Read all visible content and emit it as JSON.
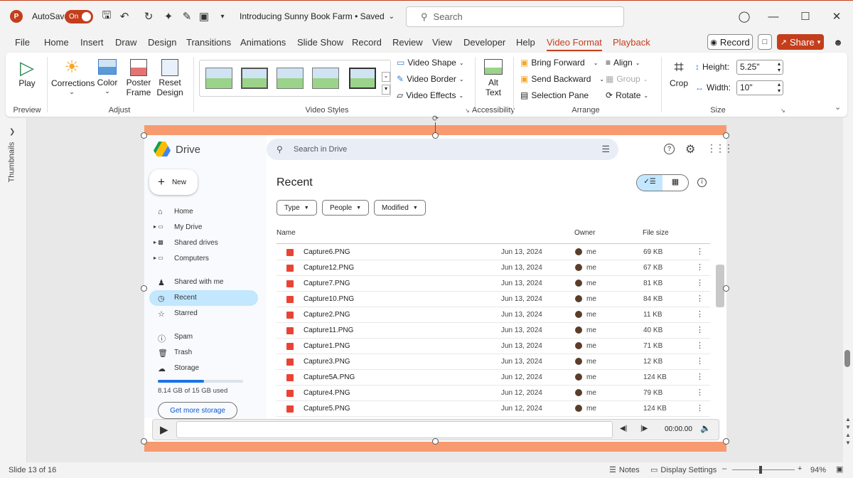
{
  "title_bar": {
    "autosave_label": "AutoSave",
    "autosave_state": "On",
    "document_title": "Introducing Sunny Book Farm • Saved",
    "search_placeholder": "Search"
  },
  "menu": {
    "tabs": [
      "File",
      "Home",
      "Insert",
      "Draw",
      "Design",
      "Transitions",
      "Animations",
      "Slide Show",
      "Record",
      "Review",
      "View",
      "Developer",
      "Help",
      "Video Format",
      "Playback"
    ],
    "active_tab": "Video Format",
    "record_label": "Record",
    "share_label": "Share"
  },
  "ribbon": {
    "preview": {
      "play_label": "Play",
      "group_label": "Preview"
    },
    "adjust": {
      "corrections_label": "Corrections",
      "color_label": "Color",
      "poster_frame_label": "Poster Frame",
      "reset_design_label": "Reset Design",
      "group_label": "Adjust"
    },
    "video_styles": {
      "video_shape_label": "Video Shape",
      "video_border_label": "Video Border",
      "video_effects_label": "Video Effects",
      "group_label": "Video Styles"
    },
    "accessibility": {
      "alt_text_label": "Alt Text",
      "group_label": "Accessibility"
    },
    "arrange": {
      "bring_forward_label": "Bring Forward",
      "send_backward_label": "Send Backward",
      "selection_pane_label": "Selection Pane",
      "align_label": "Align",
      "group_btn_label": "Group",
      "rotate_label": "Rotate",
      "group_label": "Arrange"
    },
    "size": {
      "crop_label": "Crop",
      "height_label": "Height:",
      "height_value": "5.25\"",
      "width_label": "Width:",
      "width_value": "10\"",
      "group_label": "Size"
    }
  },
  "thumbnails_label": "Thumbnails",
  "drive": {
    "logo_text": "Drive",
    "search_placeholder": "Search in Drive",
    "new_label": "New",
    "nav": [
      "Home",
      "My Drive",
      "Shared drives",
      "Computers",
      "Shared with me",
      "Recent",
      "Starred",
      "Spam",
      "Trash",
      "Storage"
    ],
    "storage_text": "8.14 GB of 15 GB used",
    "storage_fraction": 0.543,
    "get_storage_label": "Get more storage",
    "page_title": "Recent",
    "filters": [
      "Type",
      "People",
      "Modified"
    ],
    "columns": {
      "name": "Name",
      "owner": "Owner",
      "size": "File size"
    },
    "files": [
      {
        "name": "Capture6.PNG",
        "date": "Jun 13, 2024",
        "owner": "me",
        "size": "69 KB"
      },
      {
        "name": "Capture12.PNG",
        "date": "Jun 13, 2024",
        "owner": "me",
        "size": "67 KB"
      },
      {
        "name": "Capture7.PNG",
        "date": "Jun 13, 2024",
        "owner": "me",
        "size": "81 KB"
      },
      {
        "name": "Capture10.PNG",
        "date": "Jun 13, 2024",
        "owner": "me",
        "size": "84 KB"
      },
      {
        "name": "Capture2.PNG",
        "date": "Jun 13, 2024",
        "owner": "me",
        "size": "11 KB"
      },
      {
        "name": "Capture11.PNG",
        "date": "Jun 13, 2024",
        "owner": "me",
        "size": "40 KB"
      },
      {
        "name": "Capture1.PNG",
        "date": "Jun 13, 2024",
        "owner": "me",
        "size": "71 KB"
      },
      {
        "name": "Capture3.PNG",
        "date": "Jun 13, 2024",
        "owner": "me",
        "size": "12 KB"
      },
      {
        "name": "Capture5A.PNG",
        "date": "Jun 12, 2024",
        "owner": "me",
        "size": "124 KB"
      },
      {
        "name": "Capture4.PNG",
        "date": "Jun 12, 2024",
        "owner": "me",
        "size": "79 KB"
      },
      {
        "name": "Capture5.PNG",
        "date": "Jun 12, 2024",
        "owner": "me",
        "size": "124 KB"
      }
    ]
  },
  "player": {
    "time": "00:00.00"
  },
  "status": {
    "slide_info": "Slide 13 of 16",
    "notes_label": "Notes",
    "display_settings_label": "Display Settings",
    "zoom": "94%"
  },
  "colors": {
    "accent": "#c43e1c",
    "slide_bg": "#f79a70",
    "drive_selected": "#c2e7ff"
  }
}
